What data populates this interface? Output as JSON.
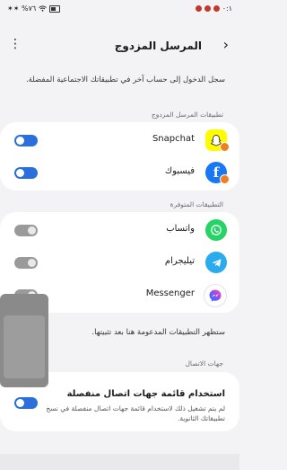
{
  "status": {
    "left": "✶✶ %٧٦",
    "time": "٠:١"
  },
  "header": {
    "title": "المرسل المزدوج"
  },
  "description": "سجل الدخول إلى حساب آخر في تطبيقاتك الاجتماعية المفضلة.",
  "sections": {
    "dual": "تطبيقات المرسل المزدوج",
    "available": "التطبيقات المتوفرة",
    "contacts": "جهات الاتصال"
  },
  "dual_apps": [
    {
      "name": "Snapchat",
      "enabled": true,
      "icon": "snapchat-icon",
      "color": "#FFFC00"
    },
    {
      "name": "فيسبوك",
      "enabled": true,
      "icon": "facebook-icon",
      "color": "#1877F2"
    }
  ],
  "available_apps": [
    {
      "name": "واتساب",
      "enabled": false,
      "icon": "whatsapp-icon",
      "color": "#25D366"
    },
    {
      "name": "تيليجرام",
      "enabled": false,
      "icon": "telegram-icon",
      "color": "#2AABEE"
    },
    {
      "name": "Messenger",
      "enabled": false,
      "icon": "messenger-icon",
      "color": "#A445F5"
    }
  ],
  "note": "ستظهر التطبيقات المدعومة هنا بعد تثبيتها.",
  "contacts": {
    "title": "استخدام قائمة جهات اتصال منفصلة",
    "desc": "لم يتم تشغيل ذلك لاستخدام قائمة جهات اتصال منفصلة في نسخ تطبيقاتك الثانوية.",
    "enabled": true
  },
  "accent": "#2A6FDB"
}
